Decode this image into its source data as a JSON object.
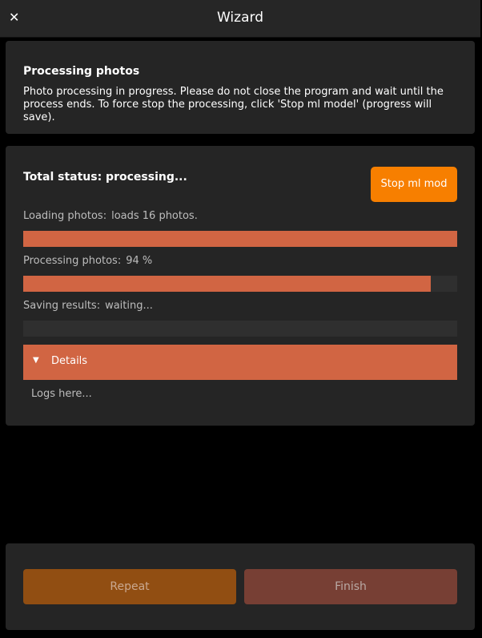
{
  "window": {
    "title": "Wizard",
    "close_glyph": "✕",
    "close_icon": "close-icon"
  },
  "info": {
    "title": "Processing photos",
    "description": "Photo processing in progress. Please do not close the program and wait until the process ends. To force stop the processing, click 'Stop ml model' (progress will save)."
  },
  "status": {
    "total_status": "Total status: processing...",
    "stop_button_label": "Stop ml mod",
    "rows": [
      {
        "label": "Loading photos:",
        "value": "loads 16 photos.",
        "progress": 1.0
      },
      {
        "label": "Processing photos:",
        "value": "94 %",
        "progress": 0.94
      },
      {
        "label": "Saving results:",
        "value": "waiting...",
        "progress": 0.0
      }
    ],
    "details_label": "Details",
    "details_icon": "caret-down-icon",
    "logs_text": "Logs here..."
  },
  "footer": {
    "repeat_label": "Repeat",
    "finish_label": "Finish"
  },
  "colors": {
    "accent": "#f77f00",
    "progress_fill": "#d16543",
    "panel_bg": "#252525",
    "repeat_bg": "#914e12",
    "finish_bg": "#773f34"
  }
}
